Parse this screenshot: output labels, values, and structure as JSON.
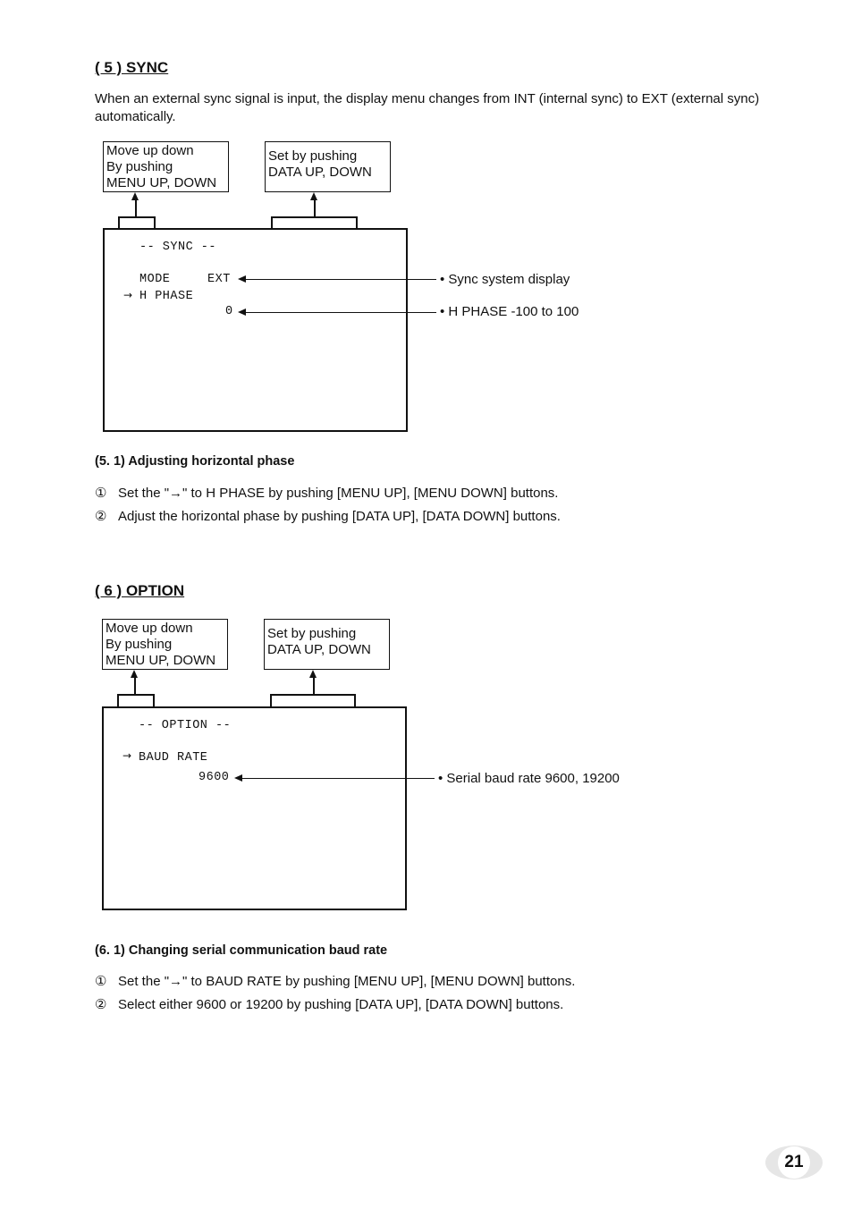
{
  "sync": {
    "heading": "( 5 )   SYNC",
    "intro": "When an external sync signal is input, the display menu changes from INT (internal sync) to EXT (external sync) automatically.",
    "callout_left": [
      "Move up down",
      "By pushing",
      "MENU UP, DOWN"
    ],
    "callout_right": [
      "Set by pushing",
      "DATA UP, DOWN"
    ],
    "screen": {
      "title": "-- SYNC --",
      "mode_label": "MODE",
      "mode_value": "EXT",
      "cursor": "→",
      "item": "H PHASE",
      "value": "0"
    },
    "notes": {
      "mode": "• Sync system display",
      "phase": "• H PHASE   -100 to 100"
    },
    "sub_heading": "(5. 1)   Adjusting horizontal phase",
    "steps": [
      {
        "num": "①",
        "text": "Set the \"→\" to H PHASE by pushing [MENU UP], [MENU DOWN] buttons."
      },
      {
        "num": "②",
        "text": "Adjust the horizontal phase by pushing [DATA UP], [DATA DOWN] buttons."
      }
    ]
  },
  "option": {
    "heading": "( 6 )   OPTION",
    "callout_left": [
      "Move up down",
      "By pushing",
      "MENU UP, DOWN"
    ],
    "callout_right": [
      "Set by pushing",
      "DATA UP, DOWN"
    ],
    "screen": {
      "title": "-- OPTION --",
      "cursor": "→",
      "item": "BAUD RATE",
      "value": "9600"
    },
    "notes": {
      "baud": "• Serial baud rate   9600, 19200"
    },
    "sub_heading": "(6. 1)   Changing serial communication baud rate",
    "steps": [
      {
        "num": "①",
        "text": "Set the \"→\" to BAUD RATE by pushing [MENU UP], [MENU DOWN] buttons."
      },
      {
        "num": "②",
        "text": "Select either 9600 or 19200 by pushing [DATA UP], [DATA DOWN] buttons."
      }
    ]
  },
  "page_number": "21"
}
